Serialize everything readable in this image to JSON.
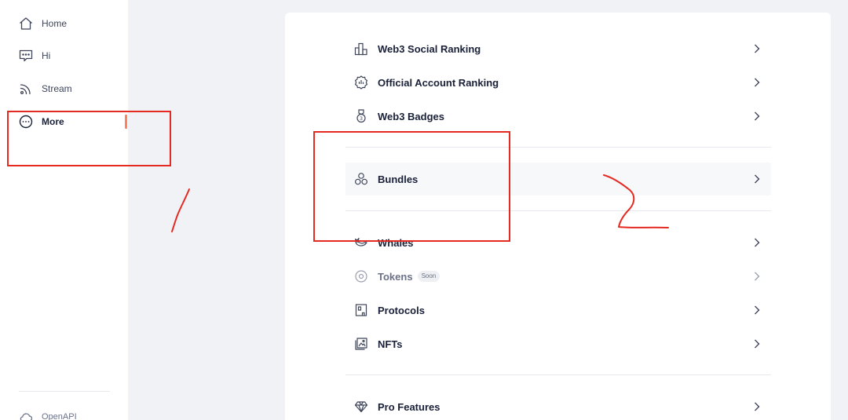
{
  "sidebar": {
    "items": [
      {
        "label": "Home",
        "icon": "home-icon"
      },
      {
        "label": "Hi",
        "icon": "chat-icon"
      },
      {
        "label": "Stream",
        "icon": "rss-icon"
      },
      {
        "label": "More",
        "icon": "more-icon",
        "active": true
      }
    ],
    "footer": {
      "label": "OpenAPI",
      "icon": "cloud-icon"
    }
  },
  "menu": {
    "groups": [
      [
        {
          "label": "Web3 Social Ranking",
          "icon": "ranking-icon"
        },
        {
          "label": "Official Account Ranking",
          "icon": "official-badge-icon"
        },
        {
          "label": "Web3 Badges",
          "icon": "medal-icon"
        }
      ],
      [
        {
          "label": "Bundles",
          "icon": "bundles-icon"
        }
      ],
      [
        {
          "label": "Whales",
          "icon": "whale-icon"
        },
        {
          "label": "Tokens",
          "icon": "token-icon",
          "badge": "Soon",
          "disabled": true
        },
        {
          "label": "Protocols",
          "icon": "protocol-icon"
        },
        {
          "label": "NFTs",
          "icon": "nft-icon"
        }
      ],
      [
        {
          "label": "Pro Features",
          "icon": "diamond-icon"
        }
      ]
    ]
  },
  "colors": {
    "accent": "#fe815f",
    "annotation": "#e52a22",
    "background": "#f1f2f5",
    "text": "#192038",
    "muted": "#6a7187"
  }
}
